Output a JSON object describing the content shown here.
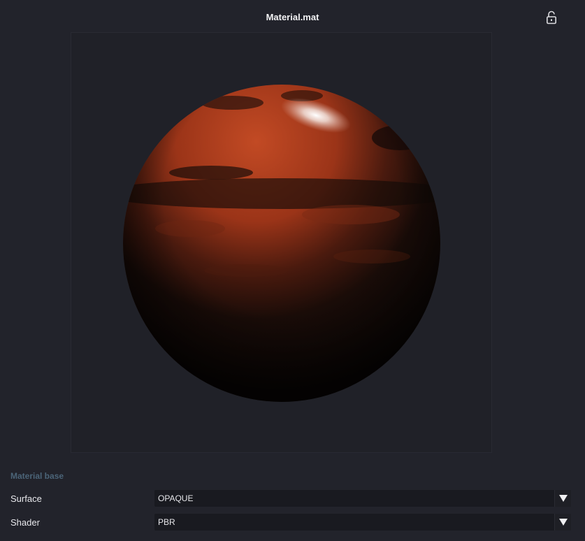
{
  "window": {
    "title": "Material.mat",
    "lock_icon": "unlocked-padlock-icon"
  },
  "preview": {
    "description_icon": "material-sphere-preview"
  },
  "material_base": {
    "header": "Material base",
    "properties": [
      {
        "label": "Surface",
        "value": "OPAQUE"
      },
      {
        "label": "Shader",
        "value": "PBR"
      }
    ]
  },
  "colors": {
    "background": "#22232b",
    "section_header": "#4b6478",
    "dropdown_bg": "#191a20",
    "rust": "#a13a1c"
  }
}
